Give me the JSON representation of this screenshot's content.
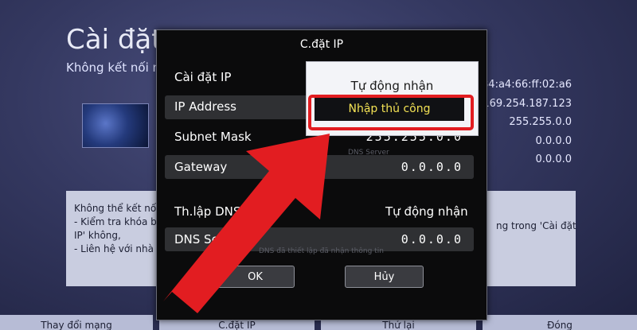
{
  "background": {
    "title": "Cài đặt m",
    "subtitle": "Không kết nối m",
    "network_values": [
      "84:a4:66:ff:02:a6",
      "169.254.187.123",
      "255.255.0.0",
      "0.0.0.0",
      "0.0.0.0"
    ],
    "info_left": [
      "Không thể kết nố",
      "- Kiểm tra khóa b",
      "IP' không,",
      "- Liên hệ với nhà"
    ],
    "info_right": "ng trong 'Cài đặt",
    "bottom_tabs": [
      "Thay đổi mạng",
      "C.đặt IP",
      "Thử lại",
      "Đóng"
    ]
  },
  "dialog": {
    "title": "C.đặt IP",
    "rows": {
      "ip_setting": "Cài đặt IP",
      "ip_address": "IP Address",
      "subnet_mask": "Subnet Mask",
      "subnet_value": "255.255.0.0",
      "gateway": "Gateway",
      "gateway_value": "0.0.0.0",
      "dns_setting": "Th.lập DNS",
      "dns_setting_value": "Tự động nhận",
      "dns_server": "DNS Se",
      "dns_server_value": "0.0.0.0"
    },
    "watermarks": [
      "DNS Server",
      "DNS đã thiết lập đã nhận thông tin"
    ],
    "buttons": {
      "ok": "OK",
      "cancel": "Hủy"
    }
  },
  "dropdown": {
    "options": [
      "Tự động nhận",
      "Nhập thủ công"
    ],
    "selected": "Nhập thủ công"
  },
  "colors": {
    "highlight": "#e21d21",
    "arrow": "#e21d21",
    "selected_text": "#f2e154"
  }
}
